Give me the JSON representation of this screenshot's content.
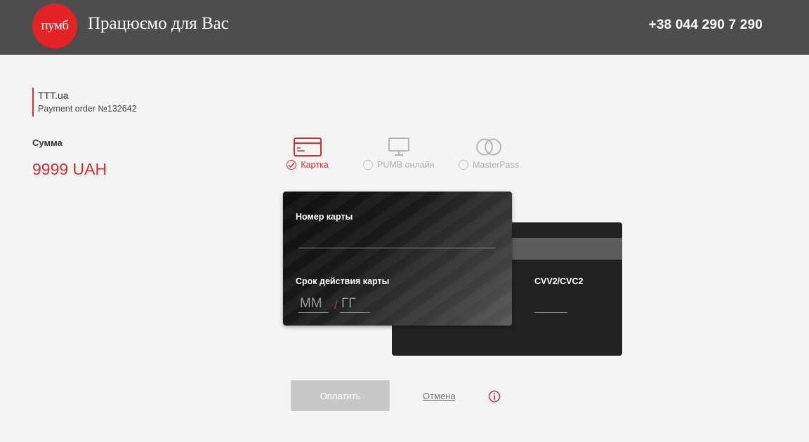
{
  "header": {
    "logo_text": "пумб",
    "slogan": "Працюємо для Вас",
    "phone": "+38 044 290 7 290"
  },
  "merchant": {
    "name": "TTT.ua",
    "order": "Payment order №132642"
  },
  "amount": {
    "label": "Сумма",
    "value": "9999 UAH"
  },
  "payment_methods": [
    {
      "label": "Картка",
      "icon": "credit-card-icon",
      "selected": true
    },
    {
      "label": "PUMB онлайн",
      "icon": "monitor-icon",
      "selected": false
    },
    {
      "label": "MasterPass",
      "icon": "masterpass-icon",
      "selected": false
    }
  ],
  "card_form": {
    "card_number_label": "Номер карты",
    "card_number_value": "",
    "expiry_label": "Срок действия карты",
    "month_placeholder": "ММ",
    "year_placeholder": "ГГ",
    "separator": "/",
    "cvv_label": "CVV2/CVC2",
    "cvv_value": ""
  },
  "actions": {
    "pay_label": "Оплатить",
    "cancel_label": "Отмена"
  },
  "colors": {
    "accent": "#d32f2f",
    "header_bg": "#4d4d4d",
    "logo_bg": "#e32326",
    "page_bg": "#f4f4f4",
    "disabled_button": "#c8c8c8"
  }
}
